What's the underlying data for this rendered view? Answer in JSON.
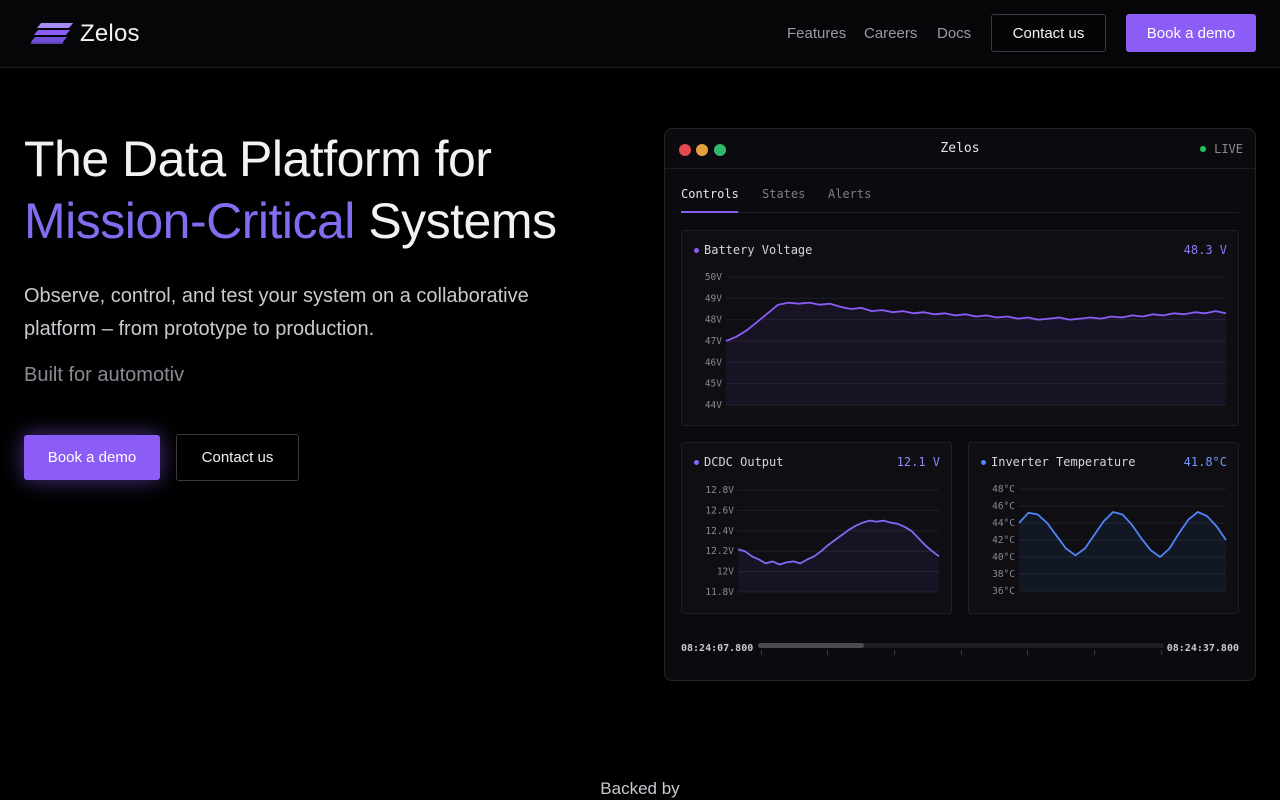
{
  "nav": {
    "brand": "Zelos",
    "links": [
      "Features",
      "Careers",
      "Docs"
    ],
    "contact_label": "Contact us",
    "demo_label": "Book a demo"
  },
  "hero": {
    "title_line1": "The Data Platform for",
    "title_accent": "Mission-Critical",
    "title_rest": " Systems",
    "subtitle": "Observe, control, and test your system on a collaborative platform – from prototype to production.",
    "typed_text": "Built for automotiv",
    "cta_demo": "Book a demo",
    "cta_contact": "Contact us",
    "accent_color": "#7f6ef0"
  },
  "dashboard": {
    "title": "Zelos",
    "live_label": "LIVE",
    "tabs": [
      "Controls",
      "States",
      "Alerts"
    ],
    "active_tab": "Controls",
    "time_start": "08:24:07.800",
    "time_end": "08:24:37.800",
    "scrub_progress": 0.26
  },
  "chart_data": [
    {
      "type": "line",
      "title": "Battery Voltage",
      "current_value": "48.3 V",
      "color": "#8b5cf6",
      "y_ticks": [
        "50V",
        "49V",
        "48V",
        "47V",
        "46V",
        "45V",
        "44V"
      ],
      "ylim": [
        44,
        50
      ],
      "series": [
        {
          "values": [
            47.0,
            47.2,
            47.5,
            47.9,
            48.3,
            48.7,
            48.8,
            48.75,
            48.8,
            48.7,
            48.75,
            48.6,
            48.5,
            48.55,
            48.4,
            48.45,
            48.35,
            48.4,
            48.3,
            48.35,
            48.25,
            48.3,
            48.2,
            48.25,
            48.15,
            48.2,
            48.1,
            48.15,
            48.05,
            48.1,
            48.0,
            48.05,
            48.1,
            48.0,
            48.05,
            48.1,
            48.05,
            48.15,
            48.1,
            48.2,
            48.15,
            48.25,
            48.2,
            48.3,
            48.25,
            48.35,
            48.3,
            48.4,
            48.3
          ]
        }
      ]
    },
    {
      "type": "line",
      "title": "DCDC Output",
      "current_value": "12.1 V",
      "color": "#7b6cf5",
      "y_ticks": [
        "12.8V",
        "12.6V",
        "12.4V",
        "12.2V",
        "12V",
        "11.8V"
      ],
      "ylim": [
        11.8,
        12.8
      ],
      "series": [
        {
          "values": [
            12.22,
            12.2,
            12.15,
            12.12,
            12.08,
            12.1,
            12.07,
            12.09,
            12.1,
            12.08,
            12.12,
            12.15,
            12.2,
            12.26,
            12.31,
            12.36,
            12.41,
            12.45,
            12.48,
            12.5,
            12.49,
            12.5,
            12.48,
            12.47,
            12.44,
            12.4,
            12.33,
            12.26,
            12.2,
            12.15
          ]
        }
      ]
    },
    {
      "type": "line",
      "title": "Inverter Temperature",
      "current_value": "41.8°C",
      "color": "#4f86f7",
      "y_ticks": [
        "48°C",
        "46°C",
        "44°C",
        "42°C",
        "40°C",
        "38°C",
        "36°C"
      ],
      "ylim": [
        36,
        48
      ],
      "series": [
        {
          "values": [
            44,
            45.2,
            45,
            44,
            42.5,
            41,
            40.2,
            41,
            42.6,
            44.2,
            45.3,
            45,
            43.8,
            42.2,
            40.8,
            40,
            41,
            42.8,
            44.4,
            45.3,
            44.8,
            43.6,
            42
          ]
        }
      ]
    }
  ]
}
